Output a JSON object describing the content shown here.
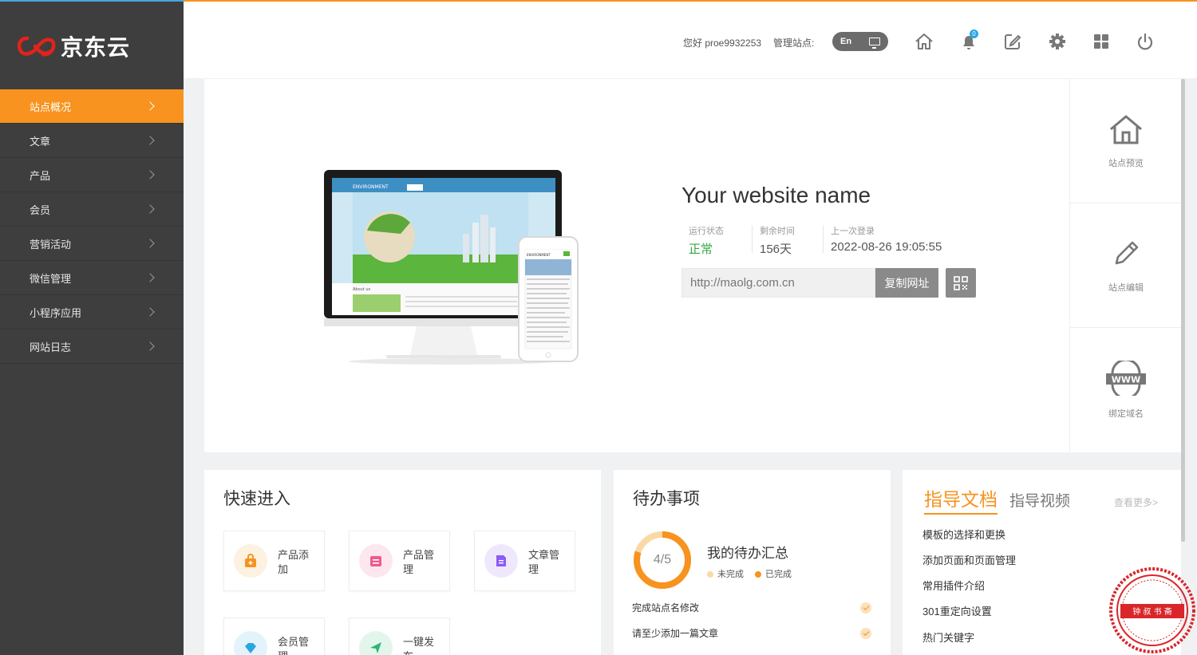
{
  "brand": {
    "logo_text": "京东云",
    "accent": "#f7931e",
    "sidebar_bg": "#3e3e3e"
  },
  "sidebar": {
    "items": [
      {
        "label": "站点概况",
        "active": true
      },
      {
        "label": "文章",
        "active": false
      },
      {
        "label": "产品",
        "active": false
      },
      {
        "label": "会员",
        "active": false
      },
      {
        "label": "营销活动",
        "active": false
      },
      {
        "label": "微信管理",
        "active": false
      },
      {
        "label": "小程序应用",
        "active": false
      },
      {
        "label": "网站日志",
        "active": false
      }
    ]
  },
  "header": {
    "greeting": "您好 proe9932253",
    "manage_site_label": "管理站点:",
    "lang_label": "En",
    "notification_count": "0",
    "icons": [
      "home-icon",
      "bell-icon",
      "edit-icon",
      "gear-icon",
      "grid-icon",
      "power-icon"
    ]
  },
  "hero": {
    "site_name": "Your website name",
    "stats": [
      {
        "key": "运行状态",
        "value": "正常",
        "value_color": "#33aa44"
      },
      {
        "key": "剩余时间",
        "value": "156天"
      },
      {
        "key": "上一次登录",
        "value": "2022-08-26 19:05:55"
      }
    ],
    "url": "http://maolg.com.cn",
    "copy_label": "复制网址"
  },
  "side_actions": [
    {
      "label": "站点预览",
      "icon": "house-icon"
    },
    {
      "label": "站点编辑",
      "icon": "pencil-icon"
    },
    {
      "label": "绑定域名",
      "icon": "www-icon"
    }
  ],
  "quick": {
    "title": "快速进入",
    "tiles": [
      {
        "label": "产品添加",
        "icon": "bag-icon",
        "color": "#f7931e",
        "bg": "#fdf1e1"
      },
      {
        "label": "产品管理",
        "icon": "box-icon",
        "color": "#f05a8a",
        "bg": "#fde7ee"
      },
      {
        "label": "文章管理",
        "icon": "doc-icon",
        "color": "#8b5cf6",
        "bg": "#efe8fd"
      },
      {
        "label": "会员管理",
        "icon": "diamond-icon",
        "color": "#2aa6e0",
        "bg": "#e3f3fb"
      },
      {
        "label": "一键发布",
        "icon": "send-icon",
        "color": "#2bb673",
        "bg": "#e3f6ec"
      }
    ]
  },
  "todo": {
    "title": "待办事项",
    "progress_label": "4/5",
    "progress_fraction": 0.8,
    "summary_title": "我的待办汇总",
    "legend_incomplete": "未完成",
    "legend_complete": "已完成",
    "incomplete_color": "#fbd9a6",
    "complete_color": "#f7931e",
    "tasks": [
      "完成站点名修改",
      "请至少添加一篇文章"
    ]
  },
  "guide": {
    "tab_active": "指导文档",
    "tab_inactive": "指导视频",
    "more": "查看更多>",
    "docs": [
      "模板的选择和更换",
      "添加页面和页面管理",
      "常用插件介绍",
      "301重定向设置",
      "热门关键字"
    ]
  },
  "mockup": {
    "monitor_brand": "ENVIRONMENT",
    "phone_brand": "ENVIRONMENT",
    "monitor_section": "About us"
  },
  "stamp": {
    "text": "钟 叔 书 斋"
  }
}
